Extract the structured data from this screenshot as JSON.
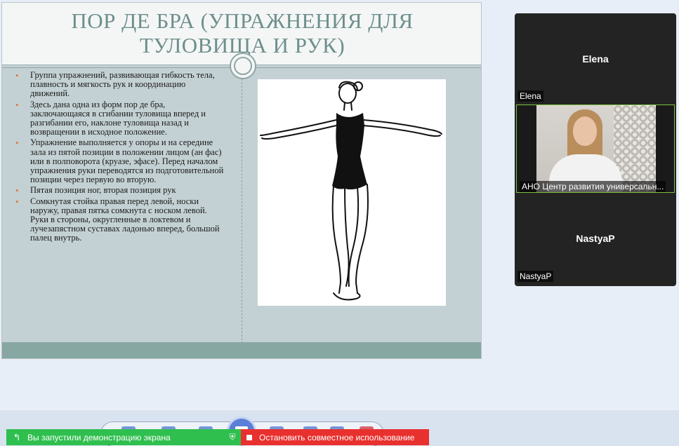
{
  "slide": {
    "title_line1": "ПОР ДЕ БРА (УПРАЖНЕНИЯ ДЛЯ",
    "title_line2": "ТУЛОВИЩА И РУК)",
    "bullets": [
      "Группа упражнений, развивающая гибкость тела, плавность и мягкость рук и координацию движений.",
      "Здесь дана одна из форм пор де бра, заключающаяся в сгибании туловища вперед и разгибании его, наклоне туловища назад и возвращении в исходное положение.",
      "Упражнение выполняется у опоры и на середине зала из пятой позиции в положении лицом (ан фас) или в полповорота (круазе, эфасе). Перед началом упражнения руки переводятся из подготовительной позиции через первую во вторую.",
      "Пятая позиция ног, вторая позиция рук",
      "Сомкнутая стойка правая перед левой, носки наружу, правая пятка сомкнута с носком левой. Руки в стороны, округленные в локтевом и лучезапястном суставах ладонью вперед, большой палец внутрь."
    ],
    "bullet_marker": "•"
  },
  "participants": [
    {
      "center_name": "Elena",
      "label": "Elena"
    },
    {
      "center_name": "",
      "label": "АНО Центр развития универсальн..."
    },
    {
      "center_name": "NastyaP",
      "label": "NastyaP"
    }
  ],
  "sharing": {
    "status_text": "Вы запустили демонстрацию экрана",
    "stop_text": "Остановить совместное использование",
    "status_icon": "arrow-icon",
    "shield_icon": "shield-check-icon"
  },
  "colors": {
    "title": "#6e8f8c",
    "share_green": "#2fbf4e",
    "stop_red": "#e8302e",
    "active_speaker_border": "#7fbf3f"
  }
}
